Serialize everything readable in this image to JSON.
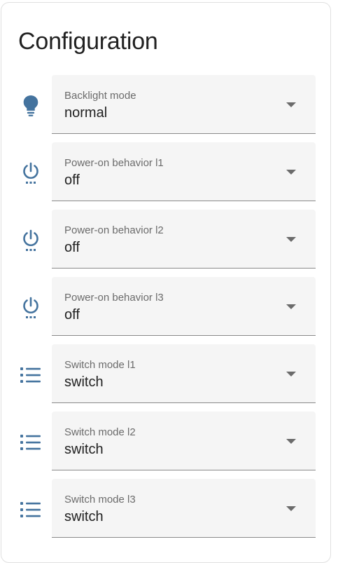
{
  "card": {
    "title": "Configuration"
  },
  "colors": {
    "icon": "#44739e"
  },
  "rows": [
    {
      "icon": "lightbulb-icon",
      "label": "Backlight mode",
      "value": "normal"
    },
    {
      "icon": "power-settings-icon",
      "label": "Power-on behavior l1",
      "value": "off"
    },
    {
      "icon": "power-settings-icon",
      "label": "Power-on behavior l2",
      "value": "off"
    },
    {
      "icon": "power-settings-icon",
      "label": "Power-on behavior l3",
      "value": "off"
    },
    {
      "icon": "format-list-bulleted-icon",
      "label": "Switch mode l1",
      "value": "switch"
    },
    {
      "icon": "format-list-bulleted-icon",
      "label": "Switch mode l2",
      "value": "switch"
    },
    {
      "icon": "format-list-bulleted-icon",
      "label": "Switch mode l3",
      "value": "switch"
    }
  ]
}
